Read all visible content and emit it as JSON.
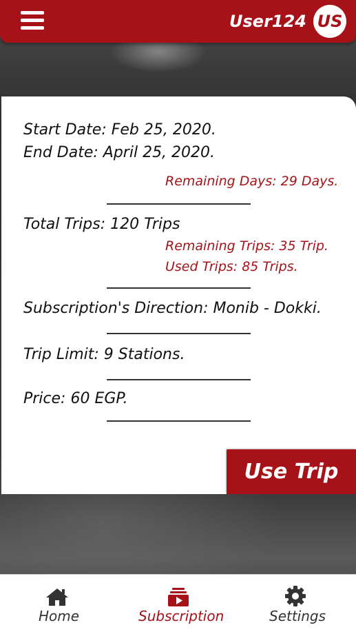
{
  "header": {
    "username": "User124",
    "avatar_initials": "US",
    "menu_icon": "hamburger-menu-icon"
  },
  "subscription": {
    "start_date": "Start Date: Feb 25, 2020.",
    "end_date": "End Date: April 25, 2020.",
    "remaining_days": "Remaining Days: 29 Days.",
    "total_trips": "Total Trips: 120 Trips",
    "remaining_trips": "Remaining Trips: 35 Trip.",
    "used_trips": "Used Trips: 85 Trips.",
    "direction": "Subscription's Direction: Monib - Dokki.",
    "trip_limit": "Trip Limit: 9 Stations.",
    "price": "Price: 60 EGP.",
    "use_trip_label": "Use Trip"
  },
  "nav": {
    "items": [
      {
        "label": "Home",
        "icon": "home-icon",
        "active": false
      },
      {
        "label": "Subscription",
        "icon": "subscription-icon",
        "active": true
      },
      {
        "label": "Settings",
        "icon": "gear-icon",
        "active": false
      }
    ]
  },
  "colors": {
    "brand": "#a61218",
    "text": "#111111",
    "nav_inactive": "#333333"
  }
}
